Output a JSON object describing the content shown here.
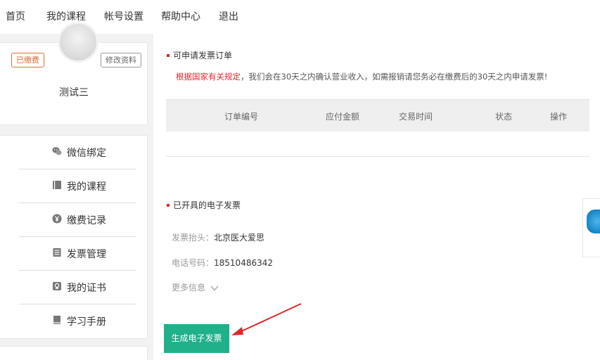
{
  "topnav": {
    "items": [
      "首页",
      "我的课程",
      "帐号设置",
      "帮助中心",
      "退出"
    ]
  },
  "profile": {
    "paid_tag": "已缴费",
    "edit_label": "修改资料",
    "username": "测试三"
  },
  "sidebar": {
    "items": [
      {
        "label": "微信绑定",
        "icon": "wechat-icon"
      },
      {
        "label": "我的课程",
        "icon": "book-icon"
      },
      {
        "label": "缴费记录",
        "icon": "yen-coin-icon"
      },
      {
        "label": "发票管理",
        "icon": "invoice-list-icon"
      },
      {
        "label": "我的证书",
        "icon": "certificate-icon"
      },
      {
        "label": "学习手册",
        "icon": "handbook-icon"
      }
    ]
  },
  "main": {
    "orders_title": "可申请发票订单",
    "notice_red": "根据国家有关规定",
    "notice_rest": "，我们会在30天之内确认营业收入，如需报销请您务必在缴费后的30天之内申请发票!",
    "columns": [
      "订单编号",
      "应付金额",
      "交易时间",
      "状态",
      "操作"
    ],
    "issued_title": "已开具的电子发票",
    "invoice_header_label": "发票抬头：",
    "invoice_header_value": "北京医大爱思",
    "phone_label": "电话号码：",
    "phone_value": "18510486342",
    "more_label": "更多信息",
    "generate_button": "生成电子发票"
  },
  "colors": {
    "accent_green": "#20b08a",
    "notice_red": "#e0262b",
    "paid_orange": "#e06a33"
  }
}
